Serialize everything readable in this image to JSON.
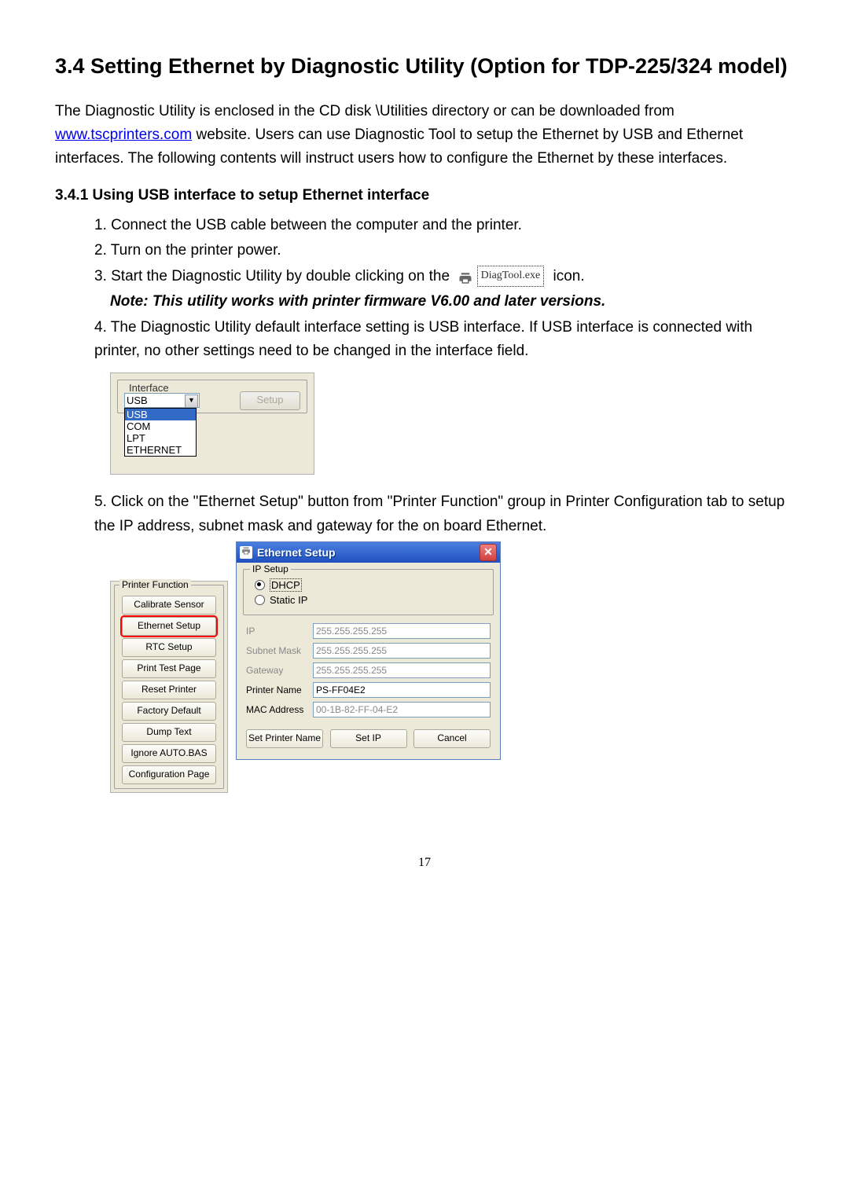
{
  "section_title": "3.4 Setting Ethernet by Diagnostic Utility (Option for TDP-225/324 model)",
  "para1_pre": "The Diagnostic Utility is enclosed in the CD disk \\Utilities directory or can be downloaded from ",
  "link_text": "www.tscprinters.com",
  "para1_post": " website. Users can use Diagnostic Tool to setup the Ethernet by USB and Ethernet interfaces. The following contents will instruct users how to configure the Ethernet by these interfaces.",
  "subsection_title": "3.4.1 Using USB interface to setup Ethernet interface",
  "step1": "1. Connect the USB cable between the computer and the printer.",
  "step2": "2. Turn on the printer power.",
  "step3_pre": "3. Start the Diagnostic Utility by double clicking on the ",
  "step3_post": " icon.",
  "exe_name": "DiagTool.exe",
  "note_text": "Note: This utility works with printer firmware V6.00 and later versions.",
  "step4": "4. The Diagnostic Utility default interface setting is USB interface. If USB interface is connected with printer, no other settings need to be changed in the interface field.",
  "step5": "5. Click on the \"Ethernet Setup\" button from \"Printer Function\" group in Printer Configuration tab to setup the IP address, subnet mask and gateway for the on board Ethernet.",
  "interface": {
    "fieldset_label": "Interface",
    "selected": "USB",
    "options": [
      "USB",
      "COM",
      "LPT",
      "ETHERNET"
    ],
    "setup_btn": "Setup"
  },
  "printer_function": {
    "label": "Printer Function",
    "buttons": [
      "Calibrate Sensor",
      "Ethernet Setup",
      "RTC Setup",
      "Print Test Page",
      "Reset Printer",
      "Factory Default",
      "Dump Text",
      "Ignore AUTO.BAS",
      "Configuration Page"
    ]
  },
  "ethernet_setup": {
    "title": "Ethernet Setup",
    "ip_setup_label": "IP Setup",
    "dhcp": "DHCP",
    "static_ip": "Static IP",
    "fields": {
      "ip_label": "IP",
      "ip_value": "255.255.255.255",
      "subnet_label": "Subnet Mask",
      "subnet_value": "255.255.255.255",
      "gateway_label": "Gateway",
      "gateway_value": "255.255.255.255",
      "printer_name_label": "Printer Name",
      "printer_name_value": "PS-FF04E2",
      "mac_label": "MAC Address",
      "mac_value": "00-1B-82-FF-04-E2"
    },
    "buttons": {
      "set_name": "Set Printer Name",
      "set_ip": "Set IP",
      "cancel": "Cancel"
    }
  },
  "page_number": "17"
}
